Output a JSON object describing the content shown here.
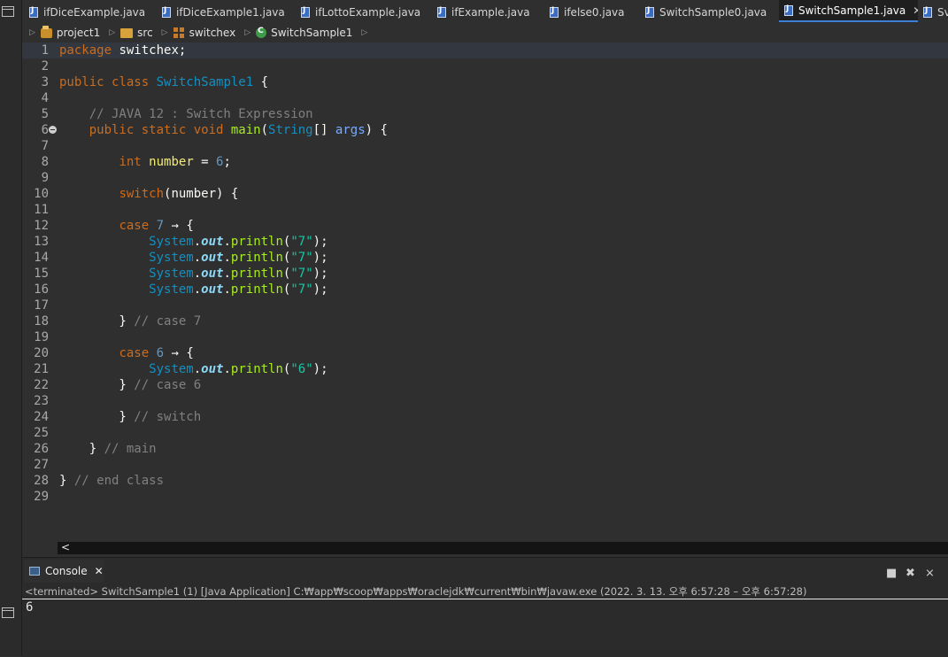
{
  "tabs": [
    {
      "label": "ifDiceExample.java",
      "active": false
    },
    {
      "label": "ifDiceExample1.java",
      "active": false
    },
    {
      "label": "ifLottoExample.java",
      "active": false
    },
    {
      "label": "ifExample.java",
      "active": false
    },
    {
      "label": "ifelse0.java",
      "active": false
    },
    {
      "label": "SwitchSample0.java",
      "active": false
    },
    {
      "label": "SwitchSample1.java",
      "active": true
    },
    {
      "label": "Sv",
      "active": false
    }
  ],
  "breadcrumb": [
    "project1",
    "src",
    "switchex",
    "SwitchSample1"
  ],
  "code_lines": [
    {
      "n": "1",
      "text": "package switchex;"
    },
    {
      "n": "2",
      "text": ""
    },
    {
      "n": "3",
      "text": "public class SwitchSample1 {"
    },
    {
      "n": "4",
      "text": ""
    },
    {
      "n": "5",
      "text": "    // JAVA 12 : Switch Expression"
    },
    {
      "n": "6",
      "text": "    public static void main(String[] args) {"
    },
    {
      "n": "7",
      "text": ""
    },
    {
      "n": "8",
      "text": "        int number = 6;"
    },
    {
      "n": "9",
      "text": ""
    },
    {
      "n": "10",
      "text": "        switch(number) {"
    },
    {
      "n": "11",
      "text": ""
    },
    {
      "n": "12",
      "text": "        case 7 → {"
    },
    {
      "n": "13",
      "text": "            System.out.println(\"7\");"
    },
    {
      "n": "14",
      "text": "            System.out.println(\"7\");"
    },
    {
      "n": "15",
      "text": "            System.out.println(\"7\");"
    },
    {
      "n": "16",
      "text": "            System.out.println(\"7\");"
    },
    {
      "n": "17",
      "text": ""
    },
    {
      "n": "18",
      "text": "        } // case 7"
    },
    {
      "n": "19",
      "text": ""
    },
    {
      "n": "20",
      "text": "        case 6 → {"
    },
    {
      "n": "21",
      "text": "            System.out.println(\"6\");"
    },
    {
      "n": "22",
      "text": "        } // case 6"
    },
    {
      "n": "23",
      "text": ""
    },
    {
      "n": "24",
      "text": "        } // switch"
    },
    {
      "n": "25",
      "text": ""
    },
    {
      "n": "26",
      "text": "    } // main"
    },
    {
      "n": "27",
      "text": ""
    },
    {
      "n": "28",
      "text": "} // end class"
    },
    {
      "n": "29",
      "text": ""
    }
  ],
  "code": {
    "l1_kw": "package",
    "l1_rest": " switchex;",
    "l3_kw": "public class",
    "l3_cls": "SwitchSample1",
    "l3_rest": " {",
    "l5_cmt": "    // JAVA 12 : Switch Expression",
    "l6_ind": "    ",
    "l6_kw": "public static void",
    "l6_mth": "main",
    "l6_p1": "(",
    "l6_cls": "String",
    "l6_p2": "[] ",
    "l6_param": "args",
    "l6_p3": ") {",
    "l8_ind": "        ",
    "l8_kw": "int",
    "l8_var": "number",
    "l8_eq": " = ",
    "l8_num": "6",
    "l8_end": ";",
    "l10_ind": "        ",
    "l10_kw": "switch",
    "l10_rest": "(number) {",
    "case7_ind": "        ",
    "case_kw": "case",
    "case7_num": "7",
    "case_arrow": " → {",
    "print_ind": "            ",
    "sys": "System",
    "dot": ".",
    "out": "out",
    "println": "println",
    "str7": "\"7\"",
    "str6": "\"6\"",
    "l18_brace": "        } ",
    "l18_cmt": "// case 7",
    "case6_num": "6",
    "l22_brace": "        } ",
    "l22_cmt": "// case 6",
    "l24_brace": "        } ",
    "l24_cmt": "// switch",
    "l26_brace": "    } ",
    "l26_cmt": "// main",
    "l28_brace": "} ",
    "l28_cmt": "// end class"
  },
  "console": {
    "tab_label": "Console",
    "status": "<terminated> SwitchSample1 (1) [Java Application] C:₩app₩scoop₩apps₩oraclejdk₩current₩bin₩javaw.exe  (2022. 3. 13. 오후 6:57:28 – 오후 6:57:28)",
    "output": "6"
  },
  "icons": {
    "tab_file": "java-file-icon",
    "close": "close-icon",
    "stop": "terminate-icon",
    "remove": "remove-launch-icon",
    "remove_all": "remove-all-terminated-icon"
  },
  "colors": {
    "editor_bg": "#2f2f2f",
    "keyword": "#cc6c1d",
    "class": "#1290c3",
    "method": "#a7ec21",
    "string": "#17c6a3",
    "comment": "#808080",
    "active_tab_underline": "#3d7fd6"
  }
}
